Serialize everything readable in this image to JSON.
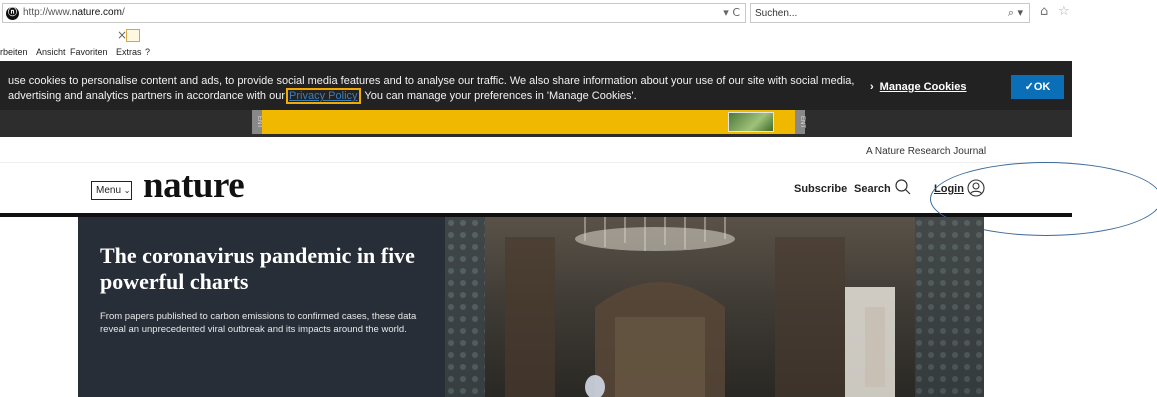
{
  "browser": {
    "url_prefix": "http://www.",
    "url_domain": "nature.com",
    "url_suffix": "/",
    "address_controls": "▾ C",
    "search_placeholder": "Suchen...",
    "search_go": "⌕ ▾",
    "tab_close": "×",
    "menu": [
      "rbeiten",
      "Ansicht",
      "Favoriten",
      "Extras",
      "?"
    ]
  },
  "cookie_banner": {
    "text_before": "use cookies to personalise content and ads, to provide social media features and to analyse our traffic. We also share information about your use of our site with social media, advertising and analytics partners in accordance with our",
    "link": "Privacy Policy",
    "text_after": ". You can manage your preferences in 'Manage Cookies'.",
    "manage_label": "Manage Cookies",
    "manage_chevron": "›",
    "ok_label": "✓OK"
  },
  "ad": {
    "tab_label": "ENT"
  },
  "header": {
    "journal_tag": "A Nature Research Journal",
    "menu_label": "Menu",
    "menu_chevron": "⌄",
    "logo": "nature",
    "subscribe_label": "Subscribe",
    "search_label": "Search",
    "login_label": "Login"
  },
  "hero": {
    "title": "The coronavirus pandemic in five powerful charts",
    "description": "From papers published to carbon emissions to confirmed cases, these data reveal an unprecedented viral outbreak and its impacts around the world."
  },
  "colors": {
    "banner_bg": "#222222",
    "ok_button": "#0b6fb8",
    "ad_yellow": "#f1b800",
    "hero_panel": "#282e38",
    "annotation": "#3b6a9a"
  }
}
